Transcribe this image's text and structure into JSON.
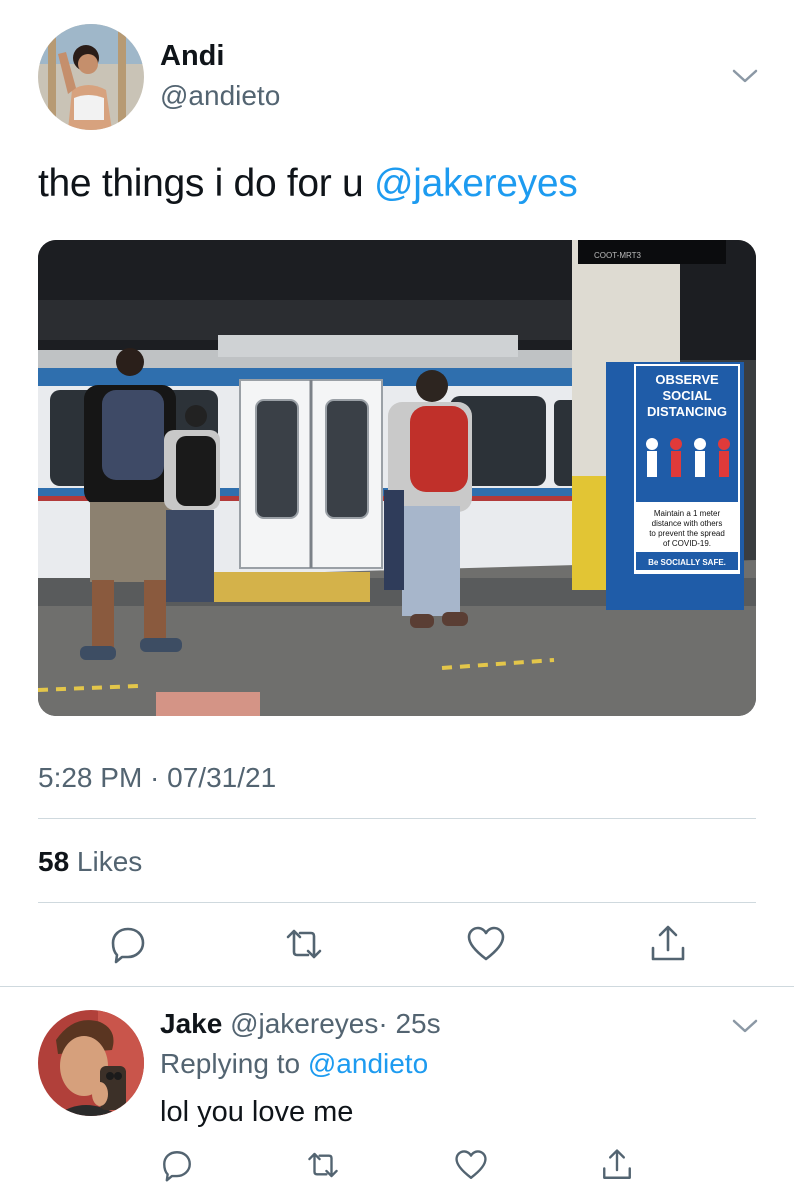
{
  "tweet": {
    "author_name": "Andi",
    "author_handle": "@andieto",
    "text": "the things i do for u ",
    "mention": "@jakereyes",
    "timestamp": "5:28 PM · 07/31/21",
    "likes_count": "58",
    "likes_label": " Likes",
    "photo": {
      "sign_line1": "OBSERVE",
      "sign_line2": "SOCIAL",
      "sign_line3": "DISTANCING",
      "sign_body1": "Maintain a 1 meter",
      "sign_body2": "distance with others",
      "sign_body3": "to prevent the spread",
      "sign_body4": "of COVID-19.",
      "sign_footer": "Be SOCIALLY SAFE.",
      "station_sign": "COOT-MRT3"
    },
    "actions": [
      "reply-icon",
      "retweet-icon",
      "like-icon",
      "share-icon"
    ]
  },
  "reply": {
    "author_name": "Jake",
    "author_handle": "@jakereyes",
    "time": "· 25s",
    "replying_prefix": "Replying to ",
    "replying_to": "@andieto",
    "text": "lol you love me",
    "actions": [
      "reply-icon",
      "retweet-icon",
      "like-icon",
      "share-icon"
    ]
  },
  "colors": {
    "accent": "#1d9bf0",
    "secondary_text": "#536471",
    "divider": "#cfd9de"
  }
}
